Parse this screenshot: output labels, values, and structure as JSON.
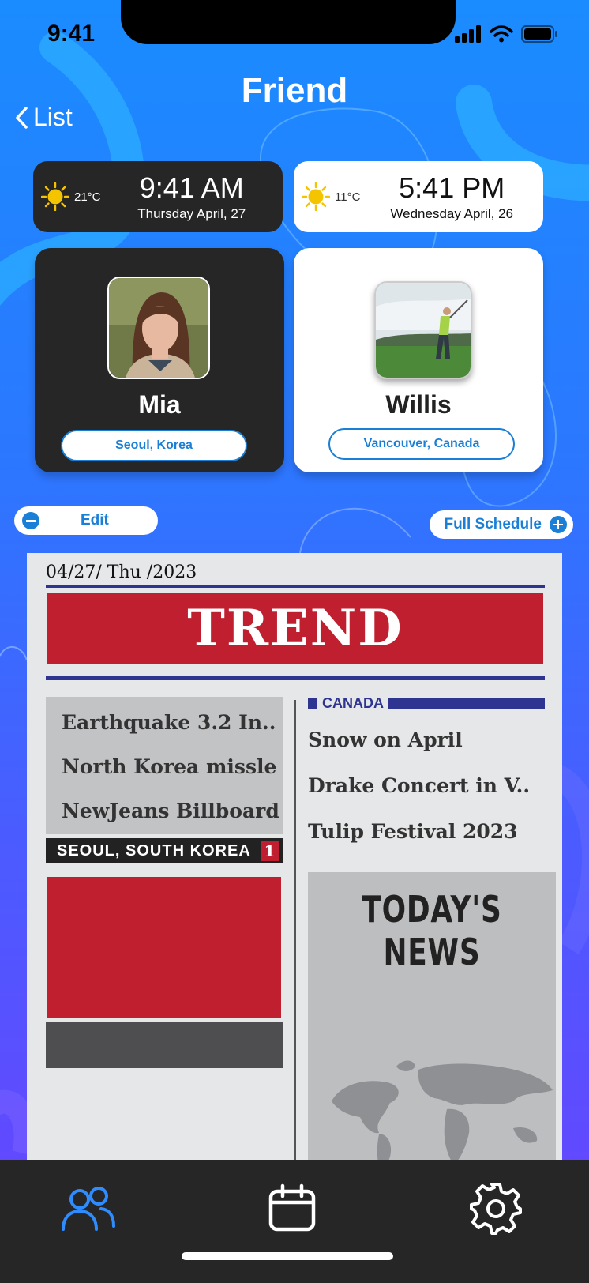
{
  "status_bar": {
    "time": "9:41"
  },
  "header": {
    "title": "Friend",
    "back_label": "List"
  },
  "time_cards": [
    {
      "temperature": "21°C",
      "time": "9:41 AM",
      "date": "Thursday April, 27",
      "icon": "sun-icon"
    },
    {
      "temperature": "11°C",
      "time": "5:41 PM",
      "date": "Wednesday April, 26",
      "icon": "sun-icon"
    }
  ],
  "friends": [
    {
      "name": "Mia",
      "location": "Seoul, Korea"
    },
    {
      "name": "Willis",
      "location": "Vancouver, Canada"
    }
  ],
  "actions": {
    "edit_label": "Edit",
    "schedule_label": "Full Schedule"
  },
  "newspaper": {
    "date": "04/27/ Thu /2023",
    "masthead": "TREND",
    "korea_headlines": [
      "Earthquake 3.2 In..",
      "North Korea missle",
      "NewJeans Billboard"
    ],
    "korea_section": "SEOUL, SOUTH KOREA",
    "korea_page_number": "1",
    "canada_section": "CANADA",
    "canada_headlines": [
      "Snow on April",
      "Drake Concert in V..",
      "Tulip Festival 2023"
    ],
    "todays_news_title": "TODAY'S NEWS"
  },
  "tab_bar": {
    "tabs": [
      {
        "icon": "friends-icon",
        "active": true
      },
      {
        "icon": "calendar-icon",
        "active": false
      },
      {
        "icon": "settings-icon",
        "active": false
      }
    ]
  },
  "colors": {
    "accent": "#1a7fd6",
    "red": "#c01f2f",
    "navy": "#2e3590",
    "dark": "#262626"
  }
}
